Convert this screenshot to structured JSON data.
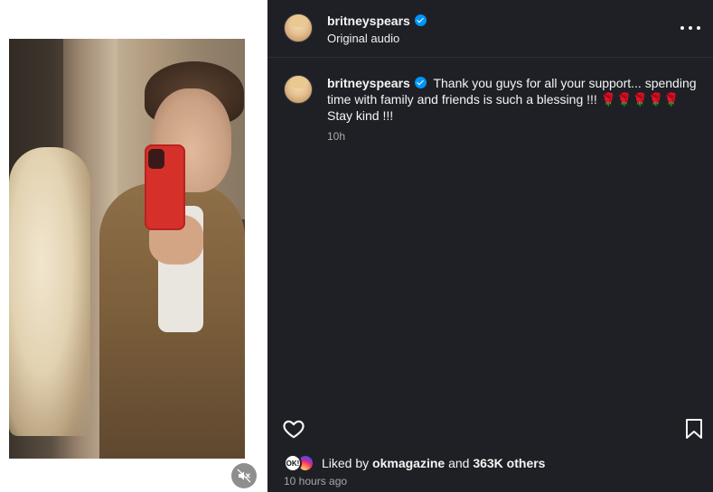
{
  "post": {
    "author": "britneyspears",
    "audio": "Original audio",
    "caption": {
      "author": "britneyspears",
      "line1": "Thank you guys for all your support... spending",
      "line2": "time with family and friends is such a blessing !!! 🌹🌹🌹🌹🌹",
      "line3": "Stay kind !!!",
      "age": "10h"
    },
    "likes": {
      "prefix": "Liked by",
      "liker": "okmagazine",
      "conjunction": "and",
      "others": "363K others",
      "liker_avatar_text": "OK!"
    },
    "timestamp": "10 hours ago"
  },
  "icons": {
    "more": "more-options-icon",
    "like": "heart-icon",
    "save": "bookmark-icon",
    "mute": "speaker-muted-icon"
  },
  "colors": {
    "panel_bg": "#1f2026",
    "verified": "#0095f6",
    "muted_text": "#a8a8a8"
  }
}
